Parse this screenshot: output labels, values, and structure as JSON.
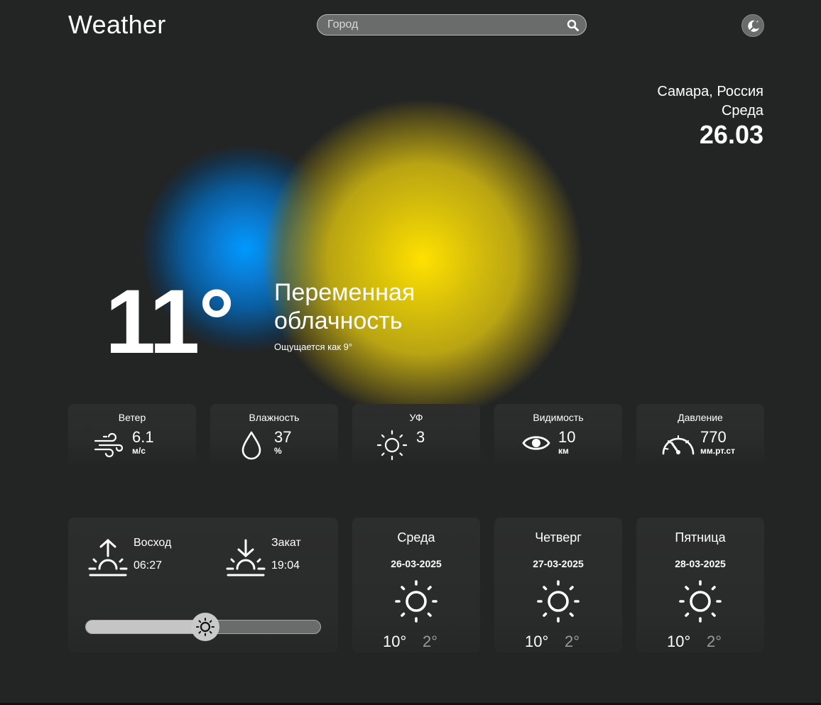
{
  "app": {
    "title": "Weather"
  },
  "search": {
    "placeholder": "Город",
    "value": "",
    "icon": "search-icon"
  },
  "theme_toggle": {
    "icon": "theme-toggle-icon"
  },
  "location": {
    "city": "Самара, Россия",
    "weekday": "Среда",
    "date": "26.03"
  },
  "current": {
    "temperature": "11°",
    "description": "Переменная облачность",
    "feels_like": "Ощущается как 9°"
  },
  "metrics": [
    {
      "label": "Ветер",
      "value": "6.1",
      "unit": "м/с",
      "icon": "wind-icon"
    },
    {
      "label": "Влажность",
      "value": "37",
      "unit": "%",
      "icon": "droplet-icon"
    },
    {
      "label": "УФ",
      "value": "3",
      "unit": "",
      "icon": "sun-icon"
    },
    {
      "label": "Видимость",
      "value": "10",
      "unit": "км",
      "icon": "eye-icon"
    },
    {
      "label": "Давление",
      "value": "770",
      "unit": "мм.рт.ст",
      "icon": "gauge-icon"
    }
  ],
  "sun": {
    "sunrise_label": "Восход",
    "sunrise_time": "06:27",
    "sunset_label": "Закат",
    "sunset_time": "19:04",
    "day_progress": 0.51
  },
  "forecast": [
    {
      "day": "Среда",
      "date": "26-03-2025",
      "high": "10°",
      "low": "2°",
      "icon": "sun-icon"
    },
    {
      "day": "Четверг",
      "date": "27-03-2025",
      "high": "10°",
      "low": "2°",
      "icon": "sun-icon"
    },
    {
      "day": "Пятница",
      "date": "28-03-2025",
      "high": "10°",
      "low": "2°",
      "icon": "sun-icon"
    }
  ],
  "colors": {
    "background": "#232424",
    "card": "#2c2d2d",
    "search_bg": "#6a6b6b",
    "glow_blue": "#0099ff",
    "glow_yellow": "#ffe100",
    "muted_text": "#9a9a9a"
  }
}
